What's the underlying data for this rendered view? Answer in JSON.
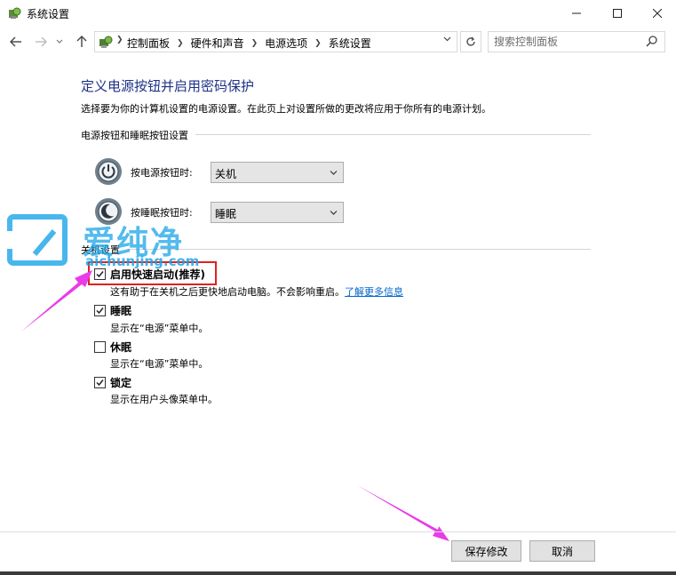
{
  "window": {
    "title": "系统设置",
    "minimize_label": "—",
    "maximize_label": "☐",
    "close_label": "✕"
  },
  "nav": {
    "breadcrumbs": [
      "控制面板",
      "硬件和声音",
      "电源选项",
      "系统设置"
    ],
    "search_placeholder": "搜索控制面板"
  },
  "main": {
    "heading": "定义电源按钮并启用密码保护",
    "description": "选择要为你的计算机设置的电源设置。在此页上对设置所做的更改将应用于你所有的电源计划。",
    "power_group": {
      "title": "电源按钮和睡眠按钮设置",
      "power_button_label": "按电源按钮时:",
      "power_button_value": "关机",
      "sleep_button_label": "按睡眠按钮时:",
      "sleep_button_value": "睡眠"
    },
    "shutdown_group": {
      "title": "关机设置",
      "options": [
        {
          "label": "启用快速启动(推荐)",
          "checked": true,
          "desc": "这有助于在关机之后更快地启动电脑。不会影响重启。",
          "link": "了解更多信息"
        },
        {
          "label": "睡眠",
          "checked": true,
          "desc": "显示在“电源”菜单中。"
        },
        {
          "label": "休眠",
          "checked": false,
          "desc": "显示在“电源”菜单中。"
        },
        {
          "label": "锁定",
          "checked": true,
          "desc": "显示在用户头像菜单中。"
        }
      ]
    }
  },
  "watermark": {
    "text": "爱纯净",
    "url": "aichunjing.com"
  },
  "footer": {
    "save_label": "保存修改",
    "cancel_label": "取消"
  },
  "colors": {
    "heading": "#1e3287",
    "link": "#0066cc",
    "highlight": "#e02020",
    "arrow": "#e83ce8",
    "watermark": "#1aa5e8"
  }
}
